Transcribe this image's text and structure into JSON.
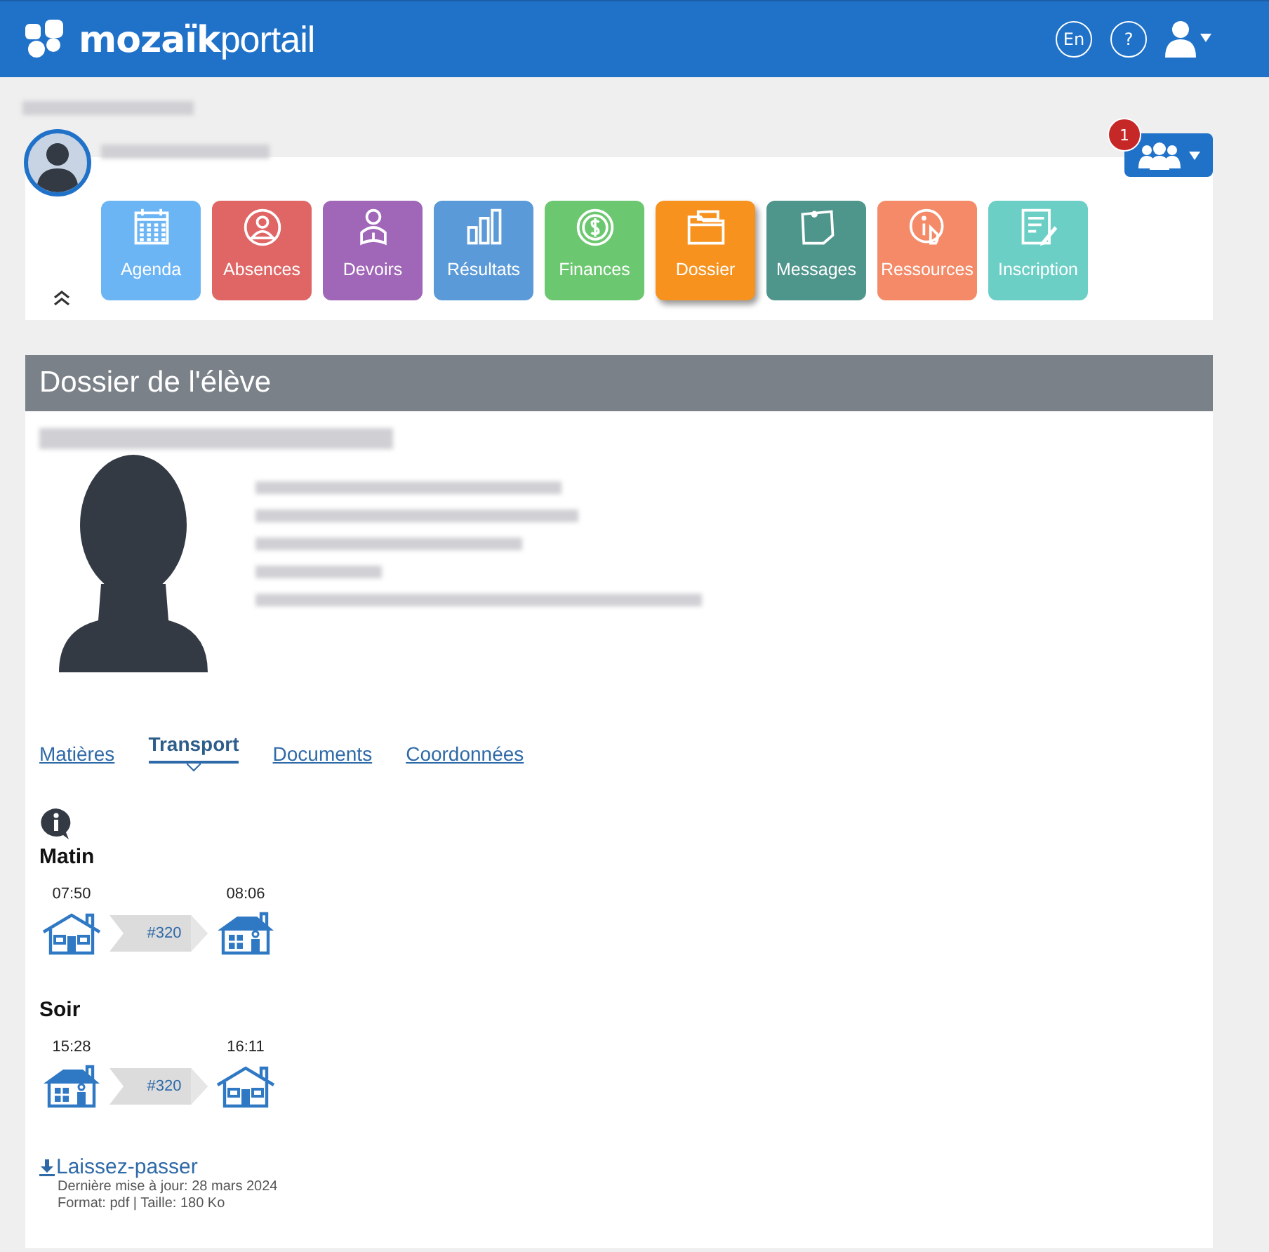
{
  "header": {
    "logo_bold": "mozaïk",
    "logo_light": "portail",
    "language": "En",
    "help": "?"
  },
  "notifications": {
    "count": "1"
  },
  "modules": [
    {
      "label": "Agenda",
      "color": "#6cb5f5",
      "selected": false
    },
    {
      "label": "Absences",
      "color": "#e06666",
      "selected": false
    },
    {
      "label": "Devoirs",
      "color": "#a066b8",
      "selected": false
    },
    {
      "label": "Résultats",
      "color": "#5b9ad8",
      "selected": false
    },
    {
      "label": "Finances",
      "color": "#6cc870",
      "selected": false
    },
    {
      "label": "Dossier",
      "color": "#f7921e",
      "selected": true
    },
    {
      "label": "Messages",
      "color": "#4e958b",
      "selected": false
    },
    {
      "label": "Ressources",
      "color": "#f48a68",
      "selected": false
    },
    {
      "label": "Inscription",
      "color": "#6bcfc5",
      "selected": false
    }
  ],
  "panel": {
    "title": "Dossier de l'élève"
  },
  "tabs": [
    {
      "label": "Matières",
      "selected": false
    },
    {
      "label": "Transport",
      "selected": true
    },
    {
      "label": "Documents",
      "selected": false
    },
    {
      "label": "Coordonnées",
      "selected": false
    }
  ],
  "transport": [
    {
      "title": "Matin",
      "route": "#320",
      "stops": [
        {
          "time": "07:50",
          "kind": "home"
        },
        {
          "time": "08:06",
          "kind": "school"
        }
      ]
    },
    {
      "title": "Soir",
      "route": "#320",
      "stops": [
        {
          "time": "15:28",
          "kind": "school"
        },
        {
          "time": "16:11",
          "kind": "home"
        }
      ]
    }
  ],
  "download": {
    "label": "Laissez-passer",
    "updated": "Dernière mise à jour: 28 mars 2024",
    "details": "Format: pdf | Taille: 180 Ko"
  }
}
